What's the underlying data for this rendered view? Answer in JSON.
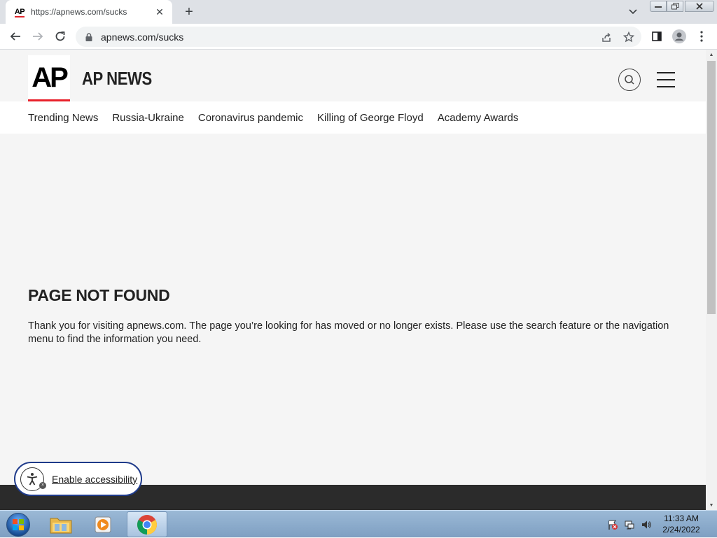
{
  "browser": {
    "tab": {
      "favicon_text": "AP",
      "title": "https://apnews.com/sucks",
      "close_glyph": "✕"
    },
    "new_tab_glyph": "+",
    "address": {
      "url": "apnews.com/sucks"
    }
  },
  "site": {
    "logo_text": "AP",
    "name": "AP NEWS",
    "nav": [
      "Trending News",
      "Russia-Ukraine",
      "Coronavirus pandemic",
      "Killing of George Floyd",
      "Academy Awards"
    ]
  },
  "content": {
    "title": "PAGE NOT FOUND",
    "message": "Thank you for visiting apnews.com. The page you’re looking for has moved or no longer exists. Please use the search feature or the navigation menu to find the information you need."
  },
  "accessibility": {
    "label": "Enable accessibility"
  },
  "taskbar": {
    "time": "11:33 AM",
    "date": "2/24/2022"
  },
  "colors": {
    "ap_red": "#e8202a",
    "taskbar": "#8fb0d2",
    "a11y_border": "#1e3a8a"
  }
}
